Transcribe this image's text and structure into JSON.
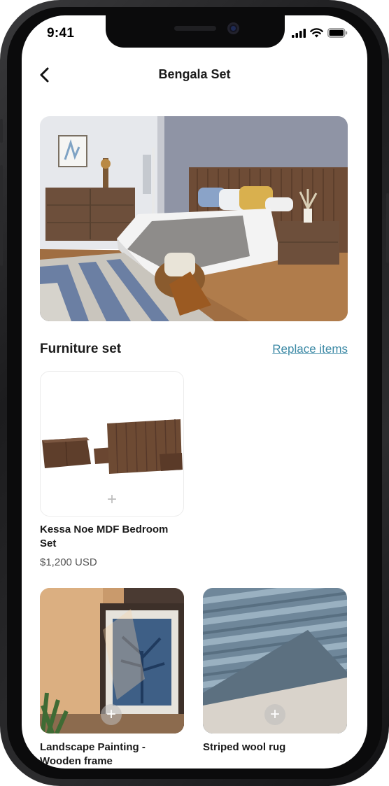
{
  "status_bar": {
    "time": "9:41"
  },
  "header": {
    "title": "Bengala Set",
    "back_icon": "chevron-left-icon"
  },
  "hero": {
    "image": "bedroom-scene"
  },
  "section": {
    "title": "Furniture set",
    "action_label": "Replace items"
  },
  "products": [
    {
      "name": "Kessa Noe MDF Bedroom Set",
      "price": "$1,200 USD",
      "image": "bedroom-furniture-set",
      "add_icon": "plus-icon"
    },
    {
      "name": "Landscape Painting - Wooden frame",
      "price": "",
      "image": "framed-palm-painting",
      "add_icon": "plus-icon"
    },
    {
      "name": "Striped wool rug",
      "price": "",
      "image": "striped-wool-rug",
      "add_icon": "plus-icon"
    }
  ],
  "colors": {
    "accent_link": "#3d8aa6",
    "text": "#1a1a1a",
    "price": "#555555"
  }
}
